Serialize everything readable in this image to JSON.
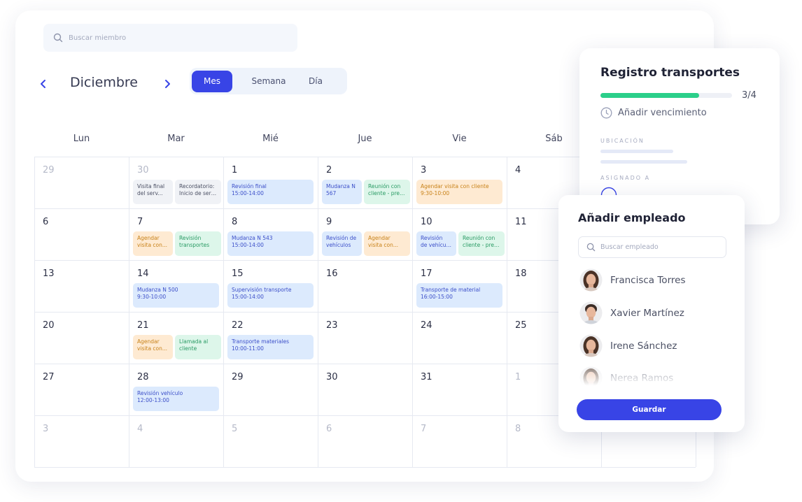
{
  "search": {
    "placeholder": "Buscar miembro"
  },
  "calendar": {
    "month": "Diciembre",
    "views": [
      "Mes",
      "Semana",
      "Día"
    ],
    "active_view": "Mes",
    "weekdays": [
      "Lun",
      "Mar",
      "Mié",
      "Jue",
      "Vie",
      "Sáb"
    ],
    "weeks": [
      [
        {
          "n": "29",
          "muted": true
        },
        {
          "n": "30",
          "muted": true
        },
        {
          "n": "1"
        },
        {
          "n": "2"
        },
        {
          "n": "3"
        },
        {
          "n": "4"
        },
        {
          "n": ""
        }
      ],
      [
        {
          "n": "6"
        },
        {
          "n": "7"
        },
        {
          "n": "8"
        },
        {
          "n": "9"
        },
        {
          "n": "10"
        },
        {
          "n": "11"
        },
        {
          "n": ""
        }
      ],
      [
        {
          "n": "13"
        },
        {
          "n": "14"
        },
        {
          "n": "15"
        },
        {
          "n": "16"
        },
        {
          "n": "17"
        },
        {
          "n": "18"
        },
        {
          "n": ""
        }
      ],
      [
        {
          "n": "20"
        },
        {
          "n": "21"
        },
        {
          "n": "22"
        },
        {
          "n": "23"
        },
        {
          "n": "24"
        },
        {
          "n": "25"
        },
        {
          "n": ""
        }
      ],
      [
        {
          "n": "27"
        },
        {
          "n": "28"
        },
        {
          "n": "29"
        },
        {
          "n": "30"
        },
        {
          "n": "31"
        },
        {
          "n": "1",
          "muted": true
        },
        {
          "n": ""
        }
      ],
      [
        {
          "n": "3",
          "muted": true
        },
        {
          "n": "4",
          "muted": true
        },
        {
          "n": "5",
          "muted": true
        },
        {
          "n": "6",
          "muted": true
        },
        {
          "n": "7",
          "muted": true
        },
        {
          "n": "8",
          "muted": true
        },
        {
          "n": ""
        }
      ]
    ],
    "events": [
      {
        "week": 0,
        "day": 1,
        "slot": 0,
        "color": "gray",
        "lines": [
          "Visita final",
          "del serv..."
        ]
      },
      {
        "week": 0,
        "day": 1,
        "slot": 1,
        "color": "gray",
        "lines": [
          "Recordatorio:",
          "Inicio de serv..."
        ]
      },
      {
        "week": 0,
        "day": 2,
        "slot": "full",
        "color": "blue",
        "lines": [
          "Revisión final",
          "15:00-14:00"
        ]
      },
      {
        "week": 0,
        "day": 3,
        "slot": 0,
        "color": "blue",
        "lines": [
          "Mudanza N",
          "567"
        ]
      },
      {
        "week": 0,
        "day": 3,
        "slot": 1,
        "color": "green",
        "lines": [
          "Reunión con",
          "cliente - pres..."
        ]
      },
      {
        "week": 0,
        "day": 4,
        "slot": "full",
        "color": "orange",
        "lines": [
          "Agendar visita con cliente",
          "9:30-10:00"
        ]
      },
      {
        "week": 1,
        "day": 1,
        "slot": 0,
        "color": "orange",
        "lines": [
          "Agendar",
          "visita con..."
        ]
      },
      {
        "week": 1,
        "day": 1,
        "slot": 1,
        "color": "green",
        "lines": [
          "Revisión",
          "transportes"
        ]
      },
      {
        "week": 1,
        "day": 2,
        "slot": "full",
        "color": "blue",
        "lines": [
          "Mudanza N 543",
          "15:00-14:00"
        ]
      },
      {
        "week": 1,
        "day": 3,
        "slot": 0,
        "color": "blue",
        "lines": [
          "Revisión de",
          "vehículos"
        ]
      },
      {
        "week": 1,
        "day": 3,
        "slot": 1,
        "color": "orange",
        "lines": [
          "Agendar",
          "visita con..."
        ]
      },
      {
        "week": 1,
        "day": 4,
        "slot": 0,
        "color": "blue",
        "lines": [
          "Revisión",
          "de vehícul..."
        ]
      },
      {
        "week": 1,
        "day": 4,
        "slot": 1,
        "color": "green",
        "lines": [
          "Reunión con",
          "cliente - pres..."
        ]
      },
      {
        "week": 2,
        "day": 1,
        "slot": "full",
        "color": "blue",
        "lines": [
          "Mudanza N 500",
          "9:30-10:00"
        ]
      },
      {
        "week": 2,
        "day": 2,
        "slot": "full",
        "color": "blue",
        "lines": [
          "Supervisión transporte",
          "15:00-14:00"
        ]
      },
      {
        "week": 2,
        "day": 4,
        "slot": "full",
        "color": "blue",
        "lines": [
          "Transporte de material",
          "16:00-15:00"
        ]
      },
      {
        "week": 3,
        "day": 1,
        "slot": 0,
        "color": "orange",
        "lines": [
          "Agendar",
          "visita con..."
        ]
      },
      {
        "week": 3,
        "day": 1,
        "slot": 1,
        "color": "green",
        "lines": [
          "Llamada al",
          "cliente"
        ]
      },
      {
        "week": 3,
        "day": 2,
        "slot": "full",
        "color": "blue",
        "lines": [
          "Transporte materiales",
          "10:00-11:00"
        ]
      },
      {
        "week": 4,
        "day": 1,
        "slot": "full",
        "color": "blue",
        "lines": [
          "Revisión vehículo",
          "12:00-13:00"
        ]
      }
    ]
  },
  "task_panel": {
    "title": "Registro transportes",
    "progress": {
      "done": 3,
      "total": 4,
      "label": "3/4"
    },
    "due_label": "Añadir vencimiento",
    "location_label": "UBICACIÓN",
    "assigned_label": "ASIGNADO A"
  },
  "employee_panel": {
    "title": "Añadir empleado",
    "search_placeholder": "Buscar empleado",
    "employees": [
      {
        "name": "Francisca Torres",
        "gender": "f"
      },
      {
        "name": "Xavier Martínez",
        "gender": "m"
      },
      {
        "name": "Irene Sánchez",
        "gender": "f"
      },
      {
        "name": "Nerea Ramos",
        "gender": "f"
      }
    ],
    "save_label": "Guardar"
  },
  "colors": {
    "accent": "#3844e6",
    "progress": "#2bcf8a"
  }
}
